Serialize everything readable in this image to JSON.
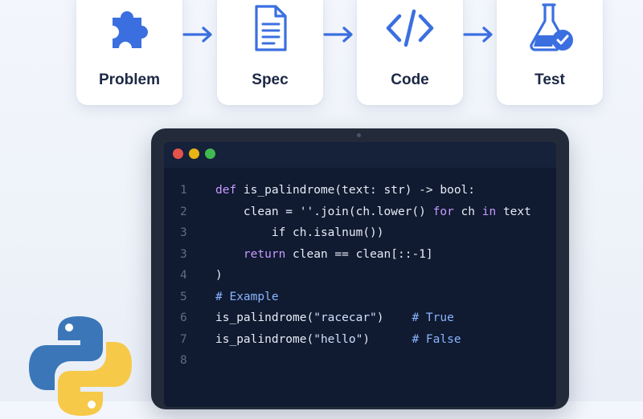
{
  "pipeline": {
    "steps": [
      {
        "label": "Problem",
        "icon": "puzzle-icon"
      },
      {
        "label": "Spec",
        "icon": "document-icon"
      },
      {
        "label": "Code",
        "icon": "code-brackets-icon"
      },
      {
        "label": "Test",
        "icon": "flask-check-icon"
      }
    ]
  },
  "editor": {
    "window_dots": [
      "#e5534b",
      "#e7b416",
      "#3fb950"
    ],
    "lines": [
      {
        "num": "1",
        "parts": [
          {
            "t": "def ",
            "c": "kw"
          },
          {
            "t": "is_palindrome(text: str) -> bool:",
            "c": ""
          }
        ]
      },
      {
        "num": "2",
        "parts": [
          {
            "t": "    clean = ''.join(ch.lower() ",
            "c": ""
          },
          {
            "t": "for",
            "c": "kw"
          },
          {
            "t": " ch ",
            "c": ""
          },
          {
            "t": "in",
            "c": "kw"
          },
          {
            "t": " text",
            "c": ""
          }
        ]
      },
      {
        "num": "3",
        "parts": [
          {
            "t": "        if ch.isalnum())",
            "c": ""
          }
        ]
      },
      {
        "num": "3",
        "parts": [
          {
            "t": "    ",
            "c": ""
          },
          {
            "t": "return",
            "c": "kw"
          },
          {
            "t": " clean == clean[::-1]",
            "c": ""
          }
        ]
      },
      {
        "num": "4",
        "parts": [
          {
            "t": ")",
            "c": ""
          }
        ]
      },
      {
        "num": "5",
        "parts": [
          {
            "t": "# Example",
            "c": "cm"
          }
        ]
      },
      {
        "num": "6",
        "parts": [
          {
            "t": "is_palindrome(",
            "c": ""
          },
          {
            "t": "\"racecar\"",
            "c": "st"
          },
          {
            "t": ")    ",
            "c": ""
          },
          {
            "t": "# True",
            "c": "cm"
          }
        ]
      },
      {
        "num": "7",
        "parts": [
          {
            "t": "is_palindrome(",
            "c": ""
          },
          {
            "t": "\"hello\"",
            "c": "st"
          },
          {
            "t": ")      ",
            "c": ""
          },
          {
            "t": "# False",
            "c": "cm"
          }
        ]
      },
      {
        "num": "8",
        "parts": []
      }
    ]
  },
  "logo": {
    "icon": "python-logo-icon",
    "colors": [
      "#3b77b8",
      "#f7c948"
    ]
  },
  "colors": {
    "accent": "#3b6fe0",
    "background": "#f1f5fb",
    "laptop": "#232b3b",
    "screen": "#101a30"
  }
}
